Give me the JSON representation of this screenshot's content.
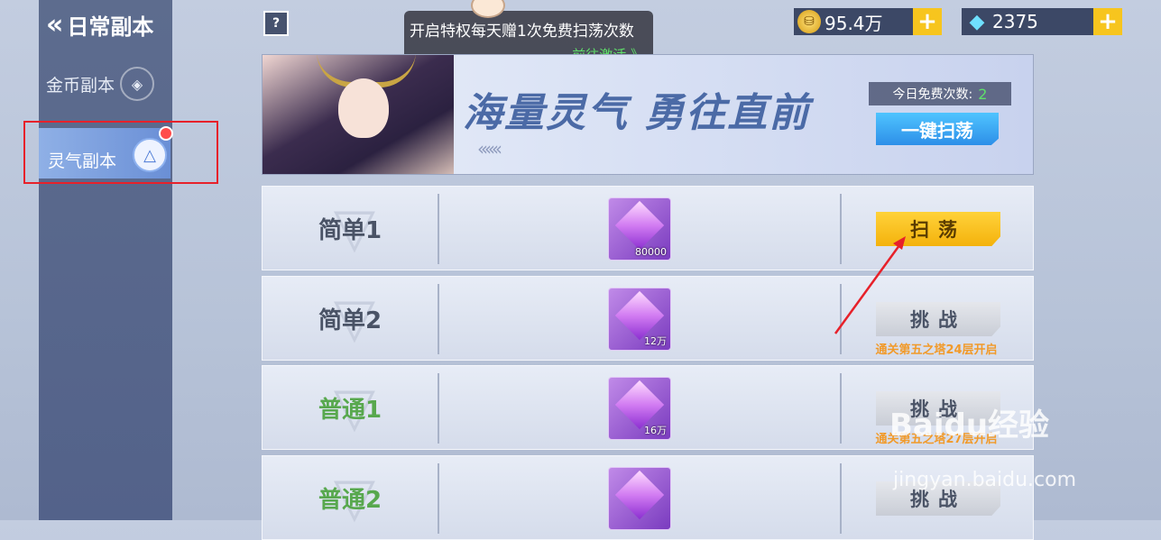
{
  "sidebar": {
    "back_label": "日常副本",
    "items": [
      {
        "label": "金币副本",
        "icon": "gold-dungeon-icon"
      },
      {
        "label": "灵气副本",
        "icon": "aura-dungeon-icon",
        "selected": true,
        "has_badge": true
      }
    ]
  },
  "topbar": {
    "help_label": "?",
    "notice_text": "开启特权每天赠1次免费扫荡次数",
    "notice_link": "前往激活 》",
    "gold_amount": "95.4万",
    "gem_amount": "2375",
    "plus_label": "+"
  },
  "banner": {
    "slogan": "海量灵气 勇往直前",
    "free_label": "今日免费次数:",
    "free_count": "2",
    "sweep_all_label": "一键扫荡"
  },
  "levels": [
    {
      "name": "简单1",
      "reward_amount": "80000",
      "action": "扫荡",
      "action_style": "yellow",
      "requirement": ""
    },
    {
      "name": "简单2",
      "reward_amount": "12万",
      "action": "挑战",
      "action_style": "gray",
      "requirement": "通关第五之塔24层开启"
    },
    {
      "name": "普通1",
      "reward_amount": "16万",
      "action": "挑战",
      "action_style": "gray",
      "requirement": "通关第五之塔27层开启"
    },
    {
      "name": "普通2",
      "reward_amount": "",
      "action": "挑战",
      "action_style": "gray",
      "requirement": ""
    }
  ],
  "watermark": {
    "brand": "Baidu经验",
    "url": "jingyan.baidu.com"
  },
  "colors": {
    "accent_yellow": "#f4b20c",
    "highlight_red": "#e7212a",
    "green_text": "#58a84e",
    "requirement_orange": "#f19a2a"
  }
}
